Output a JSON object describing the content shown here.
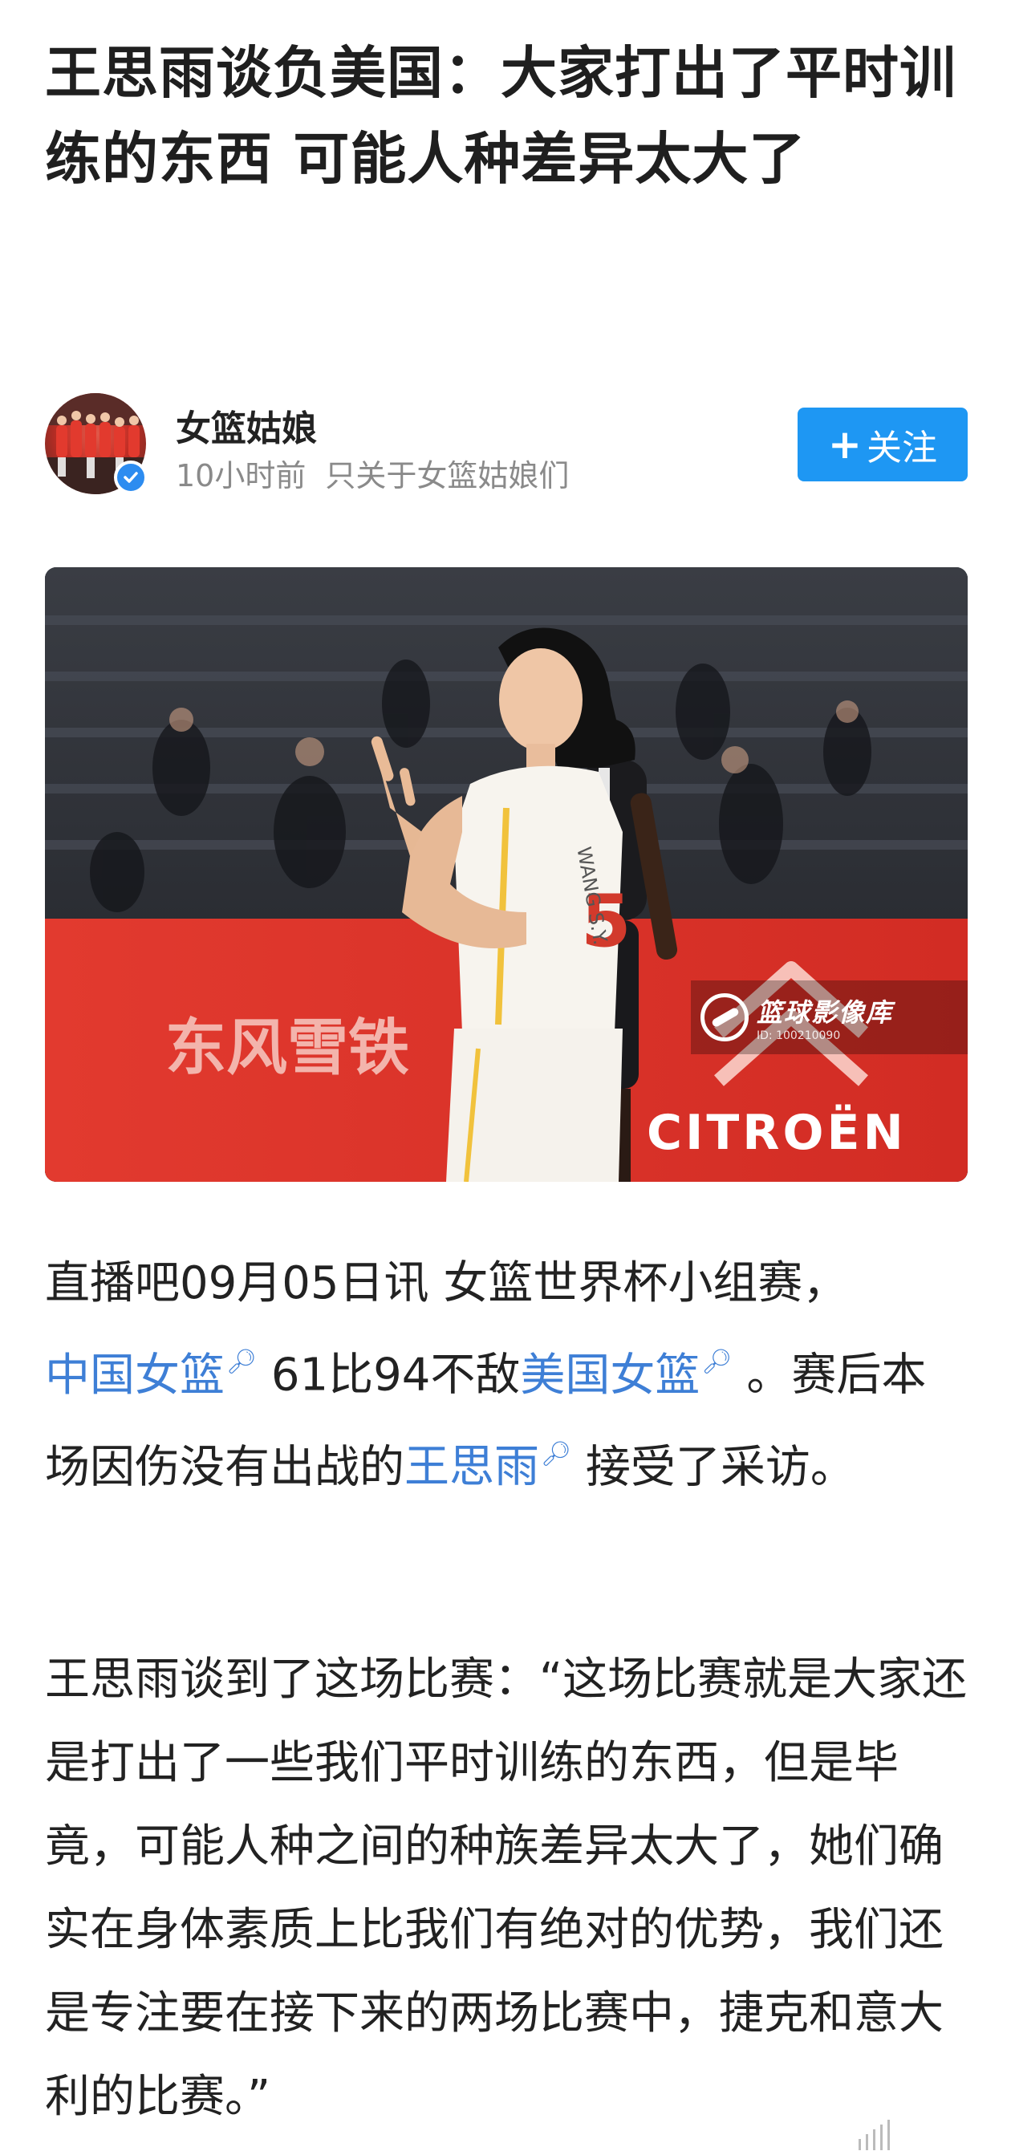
{
  "article": {
    "title": "王思雨谈负美国：大家打出了平时训练的东西 可能人种差异太大了"
  },
  "author": {
    "name": "女篮姑娘",
    "time": "10小时前",
    "tagline": "只关于女篮姑娘们",
    "verified_icon": "verified-check-icon",
    "follow_label": "关注",
    "follow_color": "#1e97f3"
  },
  "photo": {
    "banner_text": "东风雪铁",
    "sponsor": "CITROËN",
    "jersey_number": "5",
    "jersey_name": "WANG S.Y.",
    "watermark_title": "篮球影像库",
    "watermark_id": "ID: 100210090"
  },
  "body": {
    "p1": {
      "intro": "直播吧09月05日讯 女篮世界杯小组赛，",
      "team_a": "中国女篮",
      "score": " 61比94不敌",
      "team_b": "美国女篮",
      "mid": " 。赛后本场因伤没有出战的",
      "player": "王思雨",
      "end": " 接受了采访。"
    },
    "p2": "王思雨谈到了这场比赛：“这场比赛就是大家还是打出了一些我们平时训练的东西，但是毕竟，可能人种之间的种族差异太大了，她们确实在身体素质上比我们有绝对的优势，我们还是专注要在接下来的两场比赛中，捷克和意大利的比赛。”",
    "link_color": "#3e7fd6",
    "search_icon": "search-magnifier-icon"
  }
}
